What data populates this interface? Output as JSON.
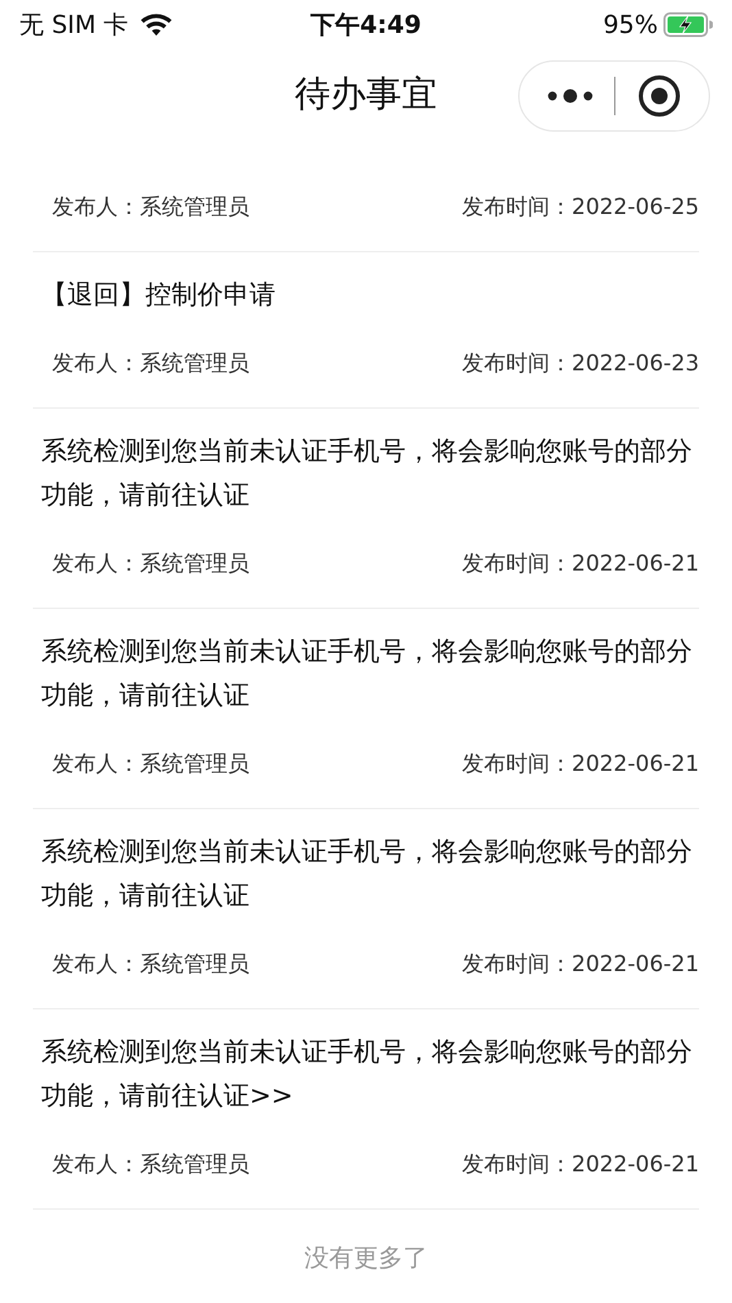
{
  "status_bar": {
    "carrier": "无 SIM 卡",
    "time": "下午4:49",
    "battery": "95%"
  },
  "nav_bar": {
    "title": "待办事宜"
  },
  "notices": [
    {
      "publisher": "发布人：系统管理员",
      "published": "发布时间：2022-06-25"
    },
    {
      "title": "【退回】控制价申请",
      "publisher": "发布人：系统管理员",
      "published": "发布时间：2022-06-23"
    },
    {
      "title": "系统检测到您当前未认证手机号，将会影响您账号的部分功能，请前往认证",
      "publisher": "发布人：系统管理员",
      "published": "发布时间：2022-06-21"
    },
    {
      "title": "系统检测到您当前未认证手机号，将会影响您账号的部分功能，请前往认证",
      "publisher": "发布人：系统管理员",
      "published": "发布时间：2022-06-21"
    },
    {
      "title": "系统检测到您当前未认证手机号，将会影响您账号的部分功能，请前往认证",
      "publisher": "发布人：系统管理员",
      "published": "发布时间：2022-06-21"
    },
    {
      "title": "系统检测到您当前未认证手机号，将会影响您账号的部分功能，请前往认证>>",
      "publisher": "发布人：系统管理员",
      "published": "发布时间：2022-06-21"
    }
  ],
  "footer": "没有更多了"
}
